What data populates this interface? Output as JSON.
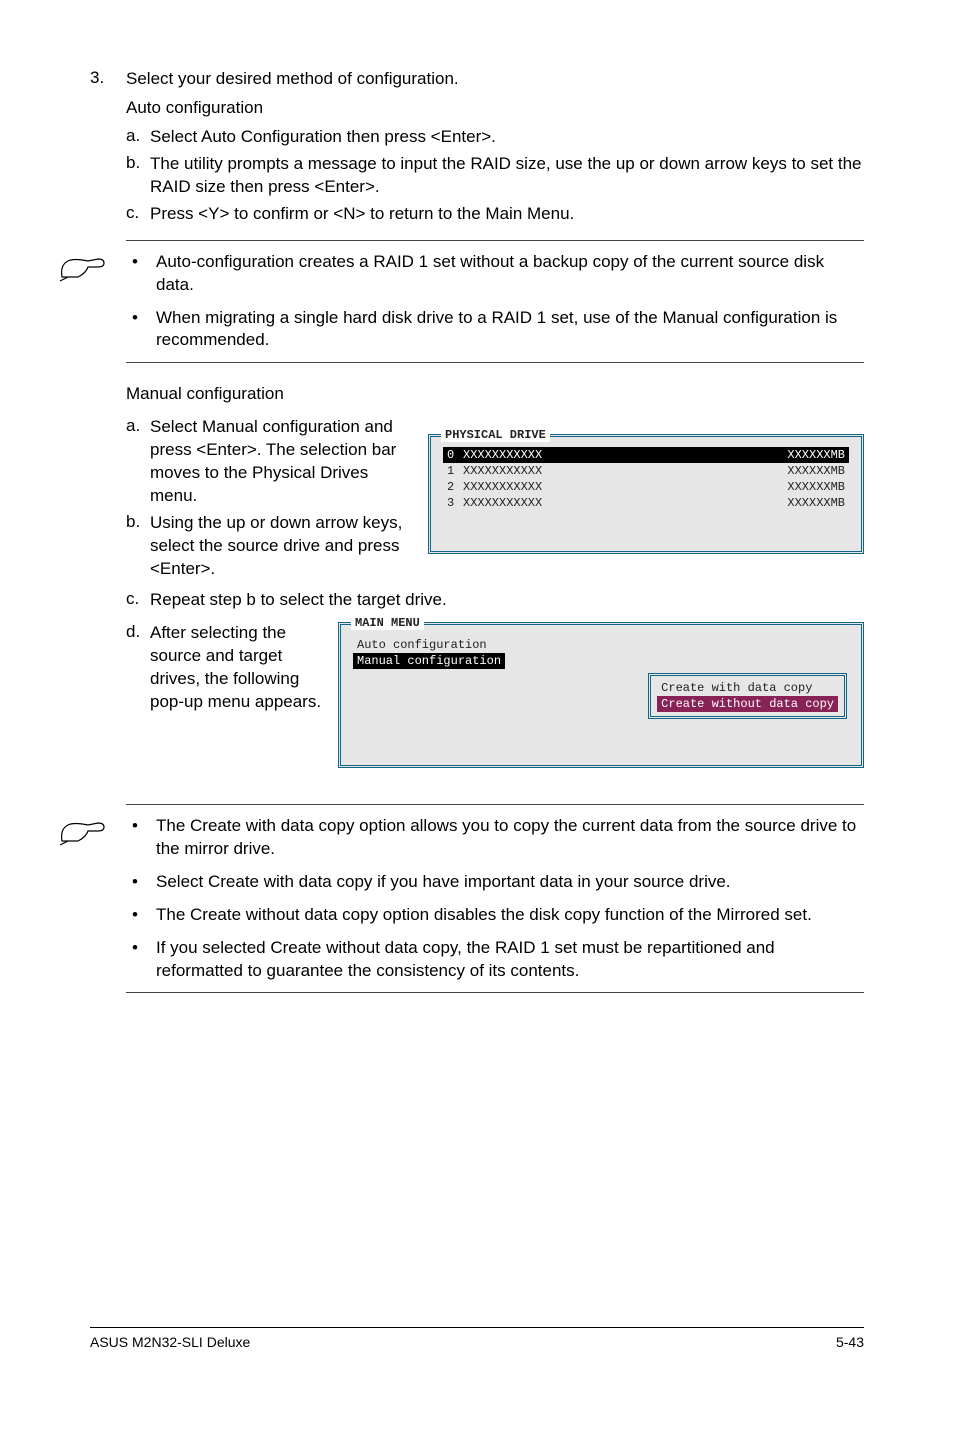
{
  "step3": {
    "number": "3.",
    "main": "Select your desired method of configuration.",
    "auto_label": "Auto configuration",
    "items": {
      "a": "Select Auto Configuration then press <Enter>.",
      "b": "The utility prompts a message to input the RAID size, use the up or down arrow keys to set the RAID size then press <Enter>.",
      "c": "Press <Y> to confirm or <N> to return to the Main Menu."
    }
  },
  "note1": {
    "b1": "Auto-configuration creates a RAID 1 set without a backup copy of the current source disk data.",
    "b2": "When migrating a single hard disk drive to a RAID 1 set, use of the Manual configuration is recommended."
  },
  "manual": {
    "heading": "Manual configuration",
    "a": "Select  Manual configuration and press <Enter>. The selection bar moves to the Physical Drives menu.",
    "b": "Using the up or down arrow keys, select the source drive and press <Enter>.",
    "c": "Repeat step b to select the target drive.",
    "d": "After selecting the source and target drives, the following pop-up menu appears."
  },
  "phys_panel": {
    "title": "PHYSICAL DRIVE",
    "rows": [
      {
        "n": "0",
        "id": "XXXXXXXXXXX",
        "sz": "XXXXXXMB"
      },
      {
        "n": "1",
        "id": "XXXXXXXXXXX",
        "sz": "XXXXXXMB"
      },
      {
        "n": "2",
        "id": "XXXXXXXXXXX",
        "sz": "XXXXXXMB"
      },
      {
        "n": "3",
        "id": "XXXXXXXXXXX",
        "sz": "XXXXXXMB"
      }
    ]
  },
  "menu_panel": {
    "title": "MAIN MENU",
    "item1": "Auto configuration",
    "item2": "Manual configuration",
    "sub1": "Create with data copy",
    "sub2": "Create without data copy"
  },
  "note2": {
    "b1": "The Create with data copy option allows you to copy the current data from the source drive to the mirror drive.",
    "b2": "Select Create with data copy if you have important data in your source drive.",
    "b3": "The Create without data copy option disables the disk copy function of the Mirrored set.",
    "b4": "If you selected Create without data copy, the RAID 1 set must be repartitioned and reformatted to guarantee the consistency of its contents."
  },
  "footer": {
    "left": "ASUS M2N32-SLI Deluxe",
    "right": "5-43"
  }
}
